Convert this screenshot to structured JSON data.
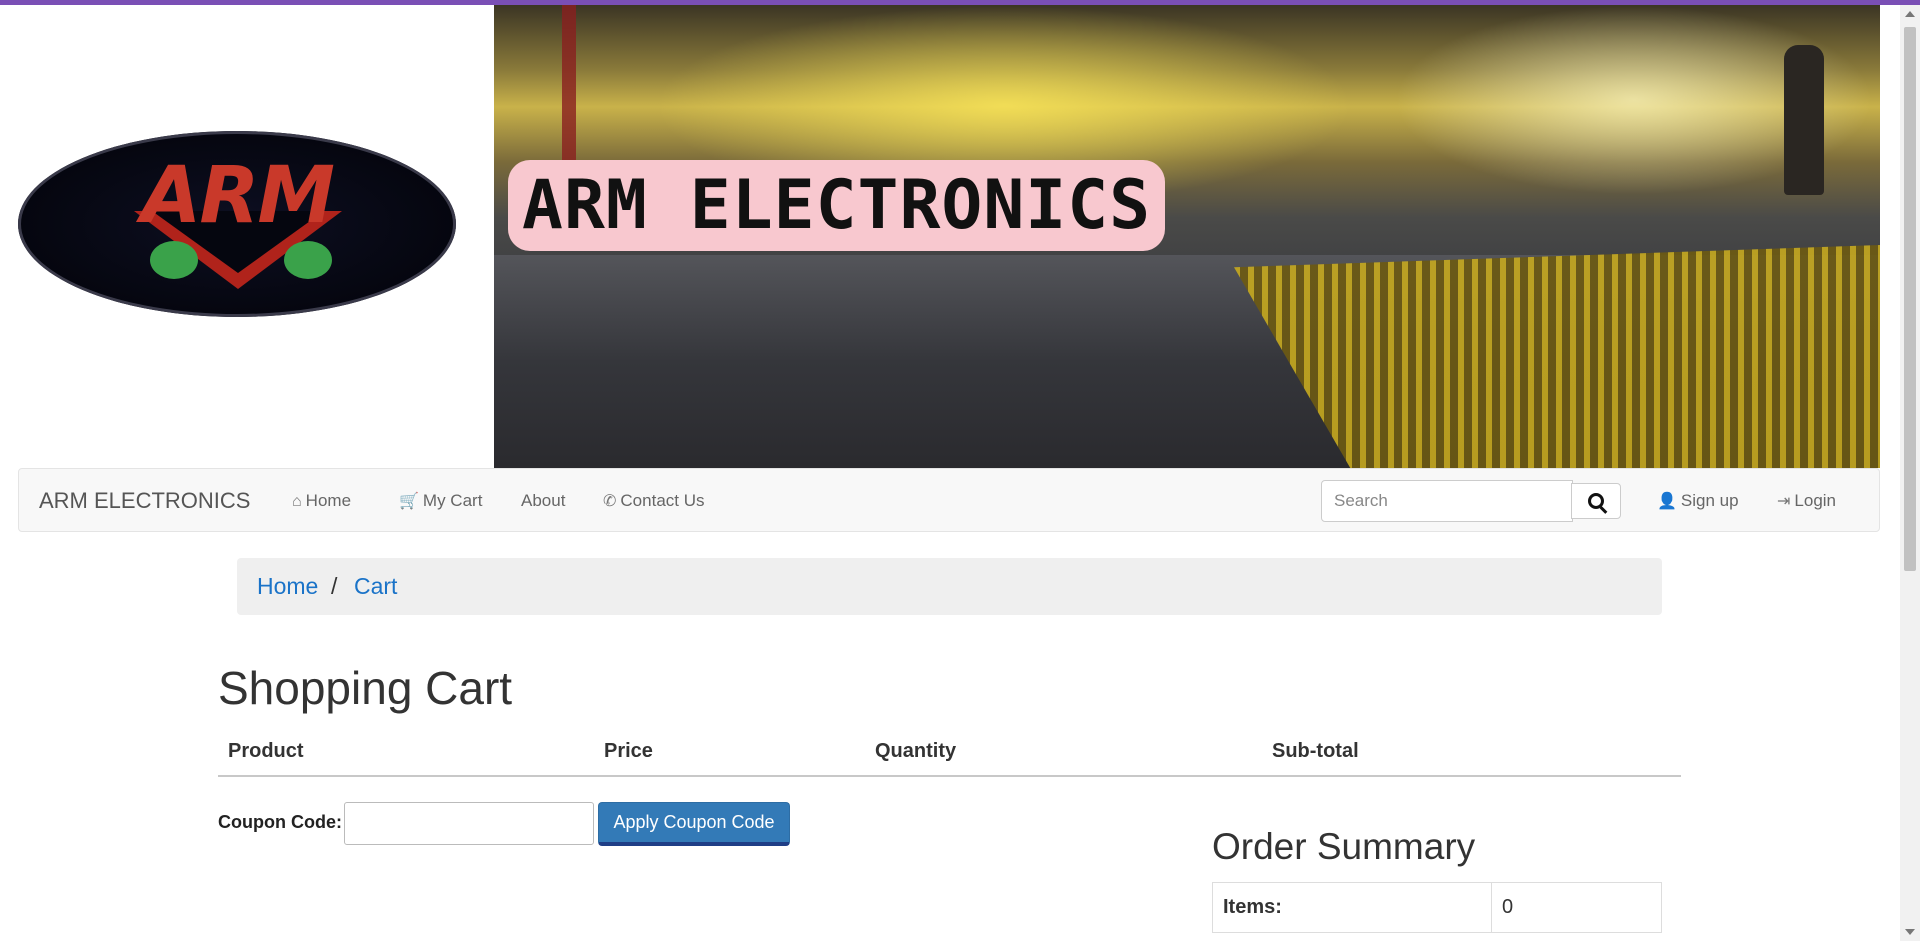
{
  "header": {
    "logo_text": "ARM",
    "banner_title": "ARM ELECTRONICS"
  },
  "navbar": {
    "brand": "ARM ELECTRONICS",
    "links": [
      {
        "label": "Home",
        "icon": "home-icon"
      },
      {
        "label": "My Cart",
        "icon": "cart-icon"
      },
      {
        "label": "About"
      },
      {
        "label": "Contact Us",
        "icon": "phone-icon"
      }
    ],
    "search": {
      "placeholder": "Search",
      "icon": "search-icon"
    },
    "signup": {
      "label": "Sign up",
      "icon": "user-icon"
    },
    "login": {
      "label": "Login",
      "icon": "login-icon"
    }
  },
  "breadcrumb": [
    "Home",
    "Cart"
  ],
  "main": {
    "title": "Shopping Cart",
    "columns": [
      "Product",
      "Price",
      "Quantity",
      "Sub-total"
    ],
    "coupon_label": "Coupon Code:",
    "coupon_value": "",
    "apply_button": "Apply Coupon Code"
  },
  "order_summary": {
    "title": "Order Summary",
    "rows": [
      {
        "label": "Items:",
        "value": "0"
      }
    ]
  },
  "colors": {
    "topbar": "#7a4fb5",
    "link": "#1a73c8",
    "primary_button": "#337ab7",
    "banner_badge": "#f8c8cf"
  }
}
